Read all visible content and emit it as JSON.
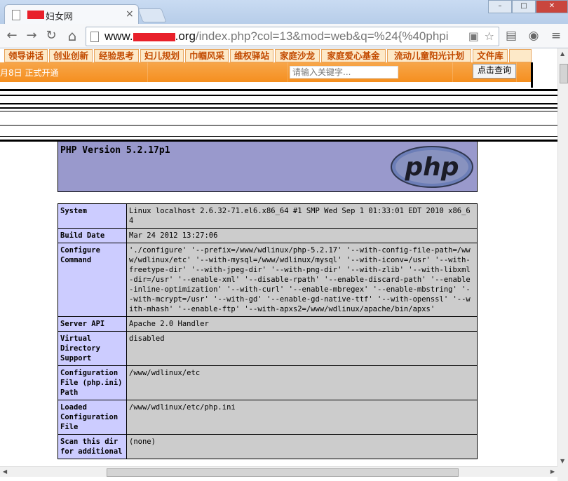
{
  "browser": {
    "tab_title": "妇女网",
    "tab_close": "×",
    "url_prefix": "www.",
    "url_suffix": ".org",
    "url_path": "/index.php?col=13&mod=web&q=%24{%40phpi",
    "icons": {
      "back": "←",
      "forward": "→",
      "reload": "↻",
      "home": "⌂",
      "star": "☆",
      "menu": "≡"
    }
  },
  "site": {
    "nav_items": [
      "领导讲话",
      "创业创新",
      "经验思考",
      "妇儿规划",
      "巾帼风采",
      "维权驿站",
      "家庭沙龙",
      "家庭爱心基金",
      "流动儿童阳光计划",
      "文件库"
    ],
    "date_text": "月8日  正式开通",
    "search_placeholder": "请输入关键字...",
    "search_button": "点击查询"
  },
  "phpinfo": {
    "version": "PHP Version 5.2.17p1",
    "logo_text": "php",
    "rows": [
      {
        "key": "System",
        "value": "Linux localhost 2.6.32-71.el6.x86_64 #1 SMP Wed Sep 1 01:33:01 EDT 2010 x86_64"
      },
      {
        "key": "Build Date",
        "value": "Mar 24 2012 13:27:06"
      },
      {
        "key": "Configure Command",
        "value": "'./configure' '--prefix=/www/wdlinux/php-5.2.17' '--with-config-file-path=/www/wdlinux/etc' '--with-mysql=/www/wdlinux/mysql' '--with-iconv=/usr' '--with-freetype-dir' '--with-jpeg-dir' '--with-png-dir' '--with-zlib' '--with-libxml-dir=/usr' '--enable-xml' '--disable-rpath' '--enable-discard-path' '--enable-inline-optimization' '--with-curl' '--enable-mbregex' '--enable-mbstring' '--with-mcrypt=/usr' '--with-gd' '--enable-gd-native-ttf' '--with-openssl' '--with-mhash' '--enable-ftp' '--with-apxs2=/www/wdlinux/apache/bin/apxs'"
      },
      {
        "key": "Server API",
        "value": "Apache 2.0 Handler"
      },
      {
        "key": "Virtual Directory Support",
        "value": "disabled"
      },
      {
        "key": "Configuration File (php.ini) Path",
        "value": "/www/wdlinux/etc"
      },
      {
        "key": "Loaded Configuration File",
        "value": "/www/wdlinux/etc/php.ini"
      },
      {
        "key": "Scan this dir for additional",
        "value": "(none)"
      }
    ]
  }
}
